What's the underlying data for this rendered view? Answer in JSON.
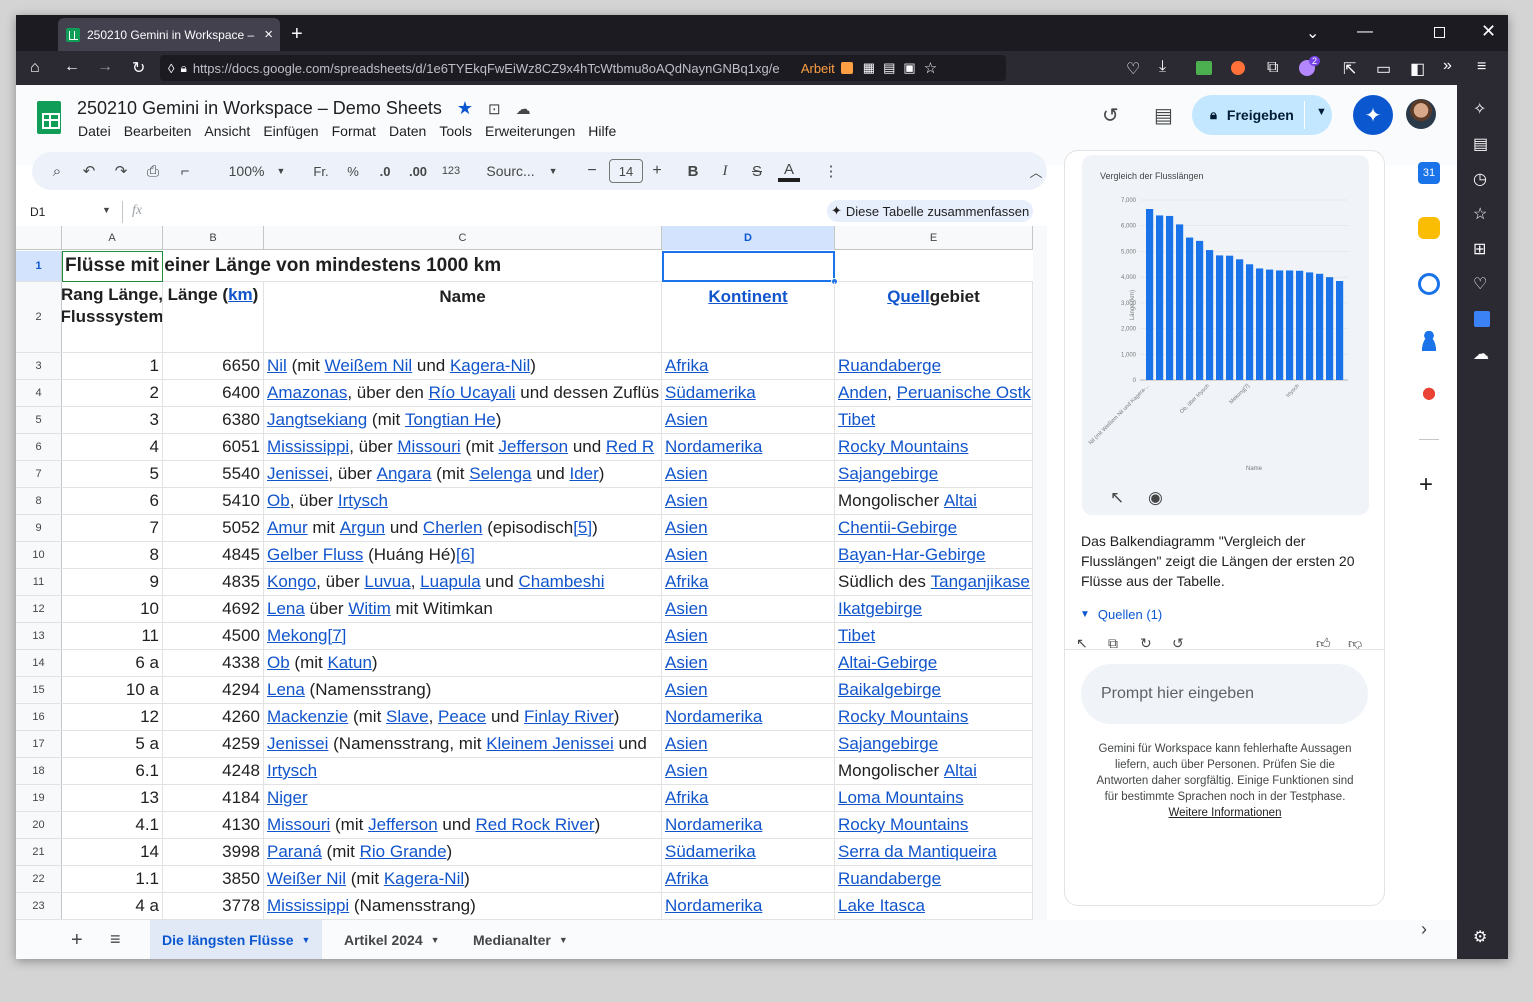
{
  "browser": {
    "tab_title": "250210 Gemini in Workspace – ",
    "url": "https://docs.google.com/spreadsheets/d/1e6TYEkqFwEiWz8CZ9x4hTcWtbmu8oAQdNaynGNBq1xg/e",
    "container_label": "Arbeit",
    "extension_badge": "2"
  },
  "doc": {
    "title": "250210 Gemini in Workspace – Demo Sheets",
    "menu": [
      "Datei",
      "Bearbeiten",
      "Ansicht",
      "Einfügen",
      "Format",
      "Daten",
      "Tools",
      "Erweiterungen",
      "Hilfe"
    ],
    "share_label": "Freigeben"
  },
  "toolbar": {
    "zoom": "100%",
    "currency": "Fr.",
    "percent": "%",
    "dec_minus": ".0",
    "dec_plus": ".00",
    "number_format": "123",
    "font": "Sourc...",
    "font_size": "14"
  },
  "formula_bar": {
    "cell_ref": "D1",
    "fx": "fx",
    "summarize_label": "Diese Tabelle zusammenfassen"
  },
  "columns": [
    "A",
    "B",
    "C",
    "D",
    "E"
  ],
  "title_row": {
    "row": "1",
    "text": "Flüsse mit einer Länge von mindestens 1000 km"
  },
  "header_row": {
    "row": "2",
    "a": "Rang Länge, Flusssystem",
    "b_pre": "Länge (",
    "b_link": "km",
    "b_post": ")",
    "c": "Name",
    "d": "Kontinent",
    "e_link": "Quell",
    "e_post": "gebiet"
  },
  "rows": [
    {
      "n": "3",
      "a": "1",
      "b": "6650",
      "c": [
        [
          "Nil",
          1
        ],
        [
          " (mit ",
          0
        ],
        [
          "Weißem Nil",
          1
        ],
        [
          " und ",
          0
        ],
        [
          "Kagera-Nil",
          1
        ],
        [
          ")",
          0
        ]
      ],
      "d": "Afrika",
      "e": [
        [
          "Ruandaberge",
          1
        ]
      ]
    },
    {
      "n": "4",
      "a": "2",
      "b": "6400",
      "c": [
        [
          "Amazonas",
          1
        ],
        [
          ", über den ",
          0
        ],
        [
          "Río Ucayali",
          1
        ],
        [
          " und dessen Zuflüs",
          0
        ]
      ],
      "d": "Südamerika",
      "e": [
        [
          "Anden",
          1
        ],
        [
          ", ",
          0
        ],
        [
          "Peruanische Ostk",
          1
        ]
      ]
    },
    {
      "n": "5",
      "a": "3",
      "b": "6380",
      "c": [
        [
          "Jangtsekiang",
          1
        ],
        [
          " (mit ",
          0
        ],
        [
          "Tongtian He",
          1
        ],
        [
          ")",
          0
        ]
      ],
      "d": "Asien",
      "e": [
        [
          "Tibet",
          1
        ]
      ]
    },
    {
      "n": "6",
      "a": "4",
      "b": "6051",
      "c": [
        [
          "Mississippi",
          1
        ],
        [
          ", über ",
          0
        ],
        [
          "Missouri",
          1
        ],
        [
          " (mit ",
          0
        ],
        [
          "Jefferson",
          1
        ],
        [
          " und ",
          0
        ],
        [
          "Red R",
          1
        ]
      ],
      "d": "Nordamerika",
      "e": [
        [
          "Rocky Mountains",
          1
        ]
      ]
    },
    {
      "n": "7",
      "a": "5",
      "b": "5540",
      "c": [
        [
          "Jenissei",
          1
        ],
        [
          ", über ",
          0
        ],
        [
          "Angara",
          1
        ],
        [
          " (mit ",
          0
        ],
        [
          "Selenga",
          1
        ],
        [
          " und ",
          0
        ],
        [
          "Ider",
          1
        ],
        [
          ")",
          0
        ]
      ],
      "d": "Asien",
      "e": [
        [
          "Sajangebirge",
          1
        ]
      ]
    },
    {
      "n": "8",
      "a": "6",
      "b": "5410",
      "c": [
        [
          "Ob",
          1
        ],
        [
          ", über ",
          0
        ],
        [
          "Irtysch",
          1
        ]
      ],
      "d": "Asien",
      "e": [
        [
          "Mongolischer ",
          0
        ],
        [
          "Altai",
          1
        ]
      ]
    },
    {
      "n": "9",
      "a": "7",
      "b": "5052",
      "c": [
        [
          "Amur",
          1
        ],
        [
          " mit ",
          0
        ],
        [
          "Argun",
          1
        ],
        [
          " und ",
          0
        ],
        [
          "Cherlen",
          1
        ],
        [
          " (episodisch",
          0
        ],
        [
          "[5]",
          1
        ],
        [
          ")",
          0
        ]
      ],
      "d": "Asien",
      "e": [
        [
          "Chentii-Gebirge",
          1
        ]
      ]
    },
    {
      "n": "10",
      "a": "8",
      "b": "4845",
      "c": [
        [
          "Gelber Fluss",
          1
        ],
        [
          " (Huáng Hé)",
          0
        ],
        [
          "[6]",
          1
        ]
      ],
      "d": "Asien",
      "e": [
        [
          "Bayan-Har-Gebirge",
          1
        ]
      ]
    },
    {
      "n": "11",
      "a": "9",
      "b": "4835",
      "c": [
        [
          "Kongo",
          1
        ],
        [
          ", über ",
          0
        ],
        [
          "Luvua",
          1
        ],
        [
          ", ",
          0
        ],
        [
          "Luapula",
          1
        ],
        [
          " und ",
          0
        ],
        [
          "Chambeshi",
          1
        ]
      ],
      "d": "Afrika",
      "e": [
        [
          "Südlich des ",
          0
        ],
        [
          "Tanganjikase",
          1
        ]
      ]
    },
    {
      "n": "12",
      "a": "10",
      "b": "4692",
      "c": [
        [
          "Lena",
          1
        ],
        [
          " über ",
          0
        ],
        [
          "Witim",
          1
        ],
        [
          " mit Witimkan",
          0
        ]
      ],
      "d": "Asien",
      "e": [
        [
          "Ikatgebirge",
          1
        ]
      ]
    },
    {
      "n": "13",
      "a": "11",
      "b": "4500",
      "c": [
        [
          "Mekong",
          1
        ],
        [
          "[7]",
          1
        ]
      ],
      "d": "Asien",
      "e": [
        [
          "Tibet",
          1
        ]
      ]
    },
    {
      "n": "14",
      "a": "6 a",
      "b": "4338",
      "c": [
        [
          "Ob",
          1
        ],
        [
          " (mit ",
          0
        ],
        [
          "Katun",
          1
        ],
        [
          ")",
          0
        ]
      ],
      "d": "Asien",
      "e": [
        [
          "Altai-Gebirge",
          1
        ]
      ]
    },
    {
      "n": "15",
      "a": "10 a",
      "b": "4294",
      "c": [
        [
          "Lena",
          1
        ],
        [
          " (Namensstrang)",
          0
        ]
      ],
      "d": "Asien",
      "e": [
        [
          "Baikalgebirge",
          1
        ]
      ]
    },
    {
      "n": "16",
      "a": "12",
      "b": "4260",
      "c": [
        [
          "Mackenzie",
          1
        ],
        [
          " (mit ",
          0
        ],
        [
          "Slave",
          1
        ],
        [
          ", ",
          0
        ],
        [
          "Peace",
          1
        ],
        [
          " und ",
          0
        ],
        [
          "Finlay River",
          1
        ],
        [
          ")",
          0
        ]
      ],
      "d": "Nordamerika",
      "e": [
        [
          "Rocky Mountains",
          1
        ]
      ]
    },
    {
      "n": "17",
      "a": "5 a",
      "b": "4259",
      "c": [
        [
          "Jenissei",
          1
        ],
        [
          " (Namensstrang, mit ",
          0
        ],
        [
          "Kleinem Jenissei",
          1
        ],
        [
          " und",
          0
        ]
      ],
      "d": "Asien",
      "e": [
        [
          "Sajangebirge",
          1
        ]
      ]
    },
    {
      "n": "18",
      "a": "6.1",
      "b": "4248",
      "c": [
        [
          "Irtysch",
          1
        ]
      ],
      "d": "Asien",
      "e": [
        [
          "Mongolischer ",
          0
        ],
        [
          "Altai",
          1
        ]
      ]
    },
    {
      "n": "19",
      "a": "13",
      "b": "4184",
      "c": [
        [
          "Niger",
          1
        ]
      ],
      "d": "Afrika",
      "e": [
        [
          "Loma Mountains",
          1
        ]
      ]
    },
    {
      "n": "20",
      "a": "4.1",
      "b": "4130",
      "c": [
        [
          "Missouri",
          1
        ],
        [
          " (mit ",
          0
        ],
        [
          "Jefferson",
          1
        ],
        [
          " und ",
          0
        ],
        [
          "Red Rock River",
          1
        ],
        [
          ")",
          0
        ]
      ],
      "d": "Nordamerika",
      "e": [
        [
          "Rocky Mountains",
          1
        ]
      ]
    },
    {
      "n": "21",
      "a": "14",
      "b": "3998",
      "c": [
        [
          "Paraná",
          1
        ],
        [
          " (mit ",
          0
        ],
        [
          "Rio Grande",
          1
        ],
        [
          ")",
          0
        ]
      ],
      "d": "Südamerika",
      "e": [
        [
          "Serra da Mantiqueira",
          1
        ]
      ]
    },
    {
      "n": "22",
      "a": "1.1",
      "b": "3850",
      "c": [
        [
          "Weißer Nil",
          1
        ],
        [
          " (mit ",
          0
        ],
        [
          "Kagera-Nil",
          1
        ],
        [
          ")",
          0
        ]
      ],
      "d": "Afrika",
      "e": [
        [
          "Ruandaberge",
          1
        ]
      ]
    },
    {
      "n": "23",
      "a": "4 a",
      "b": "3778",
      "c": [
        [
          "Mississippi",
          1
        ],
        [
          " (Namensstrang)",
          0
        ]
      ],
      "d": "Nordamerika",
      "e": [
        [
          "Lake Itasca",
          1
        ]
      ]
    }
  ],
  "sheet_tabs": [
    "Die längsten Flüsse",
    "Artikel 2024",
    "Medianalter"
  ],
  "gemini": {
    "response_text": "Das Balkendiagramm \"Vergleich der Flusslängen\" zeigt die Längen der ersten 20 Flüsse aus der Tabelle.",
    "sources_label": "Quellen (1)",
    "prompt_placeholder": "Prompt hier eingeben",
    "disclaimer": "Gemini für Workspace kann fehlerhafte Aussagen liefern, auch über Personen. Prüfen Sie die Antworten daher sorgfältig. Einige Funktionen sind für bestimmte Sprachen noch in der Testphase.",
    "more_info": "Weitere Informationen"
  },
  "chart_data": {
    "type": "bar",
    "title": "Vergleich der Flusslängen",
    "xlabel": "Name",
    "ylabel": "Länge (km)",
    "ylim": [
      0,
      7000
    ],
    "yticks": [
      "0",
      "1,000",
      "2,000",
      "3,000",
      "4,000",
      "5,000",
      "6,000",
      "7,000"
    ],
    "xtick_labels": [
      "Nil (mit Weißem Nil und Kagera-...",
      "Ob, über Irtysch",
      "Mekong[7]",
      "Irtysch"
    ],
    "values": [
      6650,
      6400,
      6380,
      6051,
      5540,
      5410,
      5052,
      4845,
      4835,
      4692,
      4500,
      4338,
      4294,
      4260,
      4259,
      4248,
      4184,
      4130,
      3998,
      3850
    ],
    "color": "#1a73e8",
    "grid": true
  },
  "colors": {
    "link": "#1155cc",
    "accent": "#0b57d0",
    "sheets_green": "#0f9d58"
  }
}
